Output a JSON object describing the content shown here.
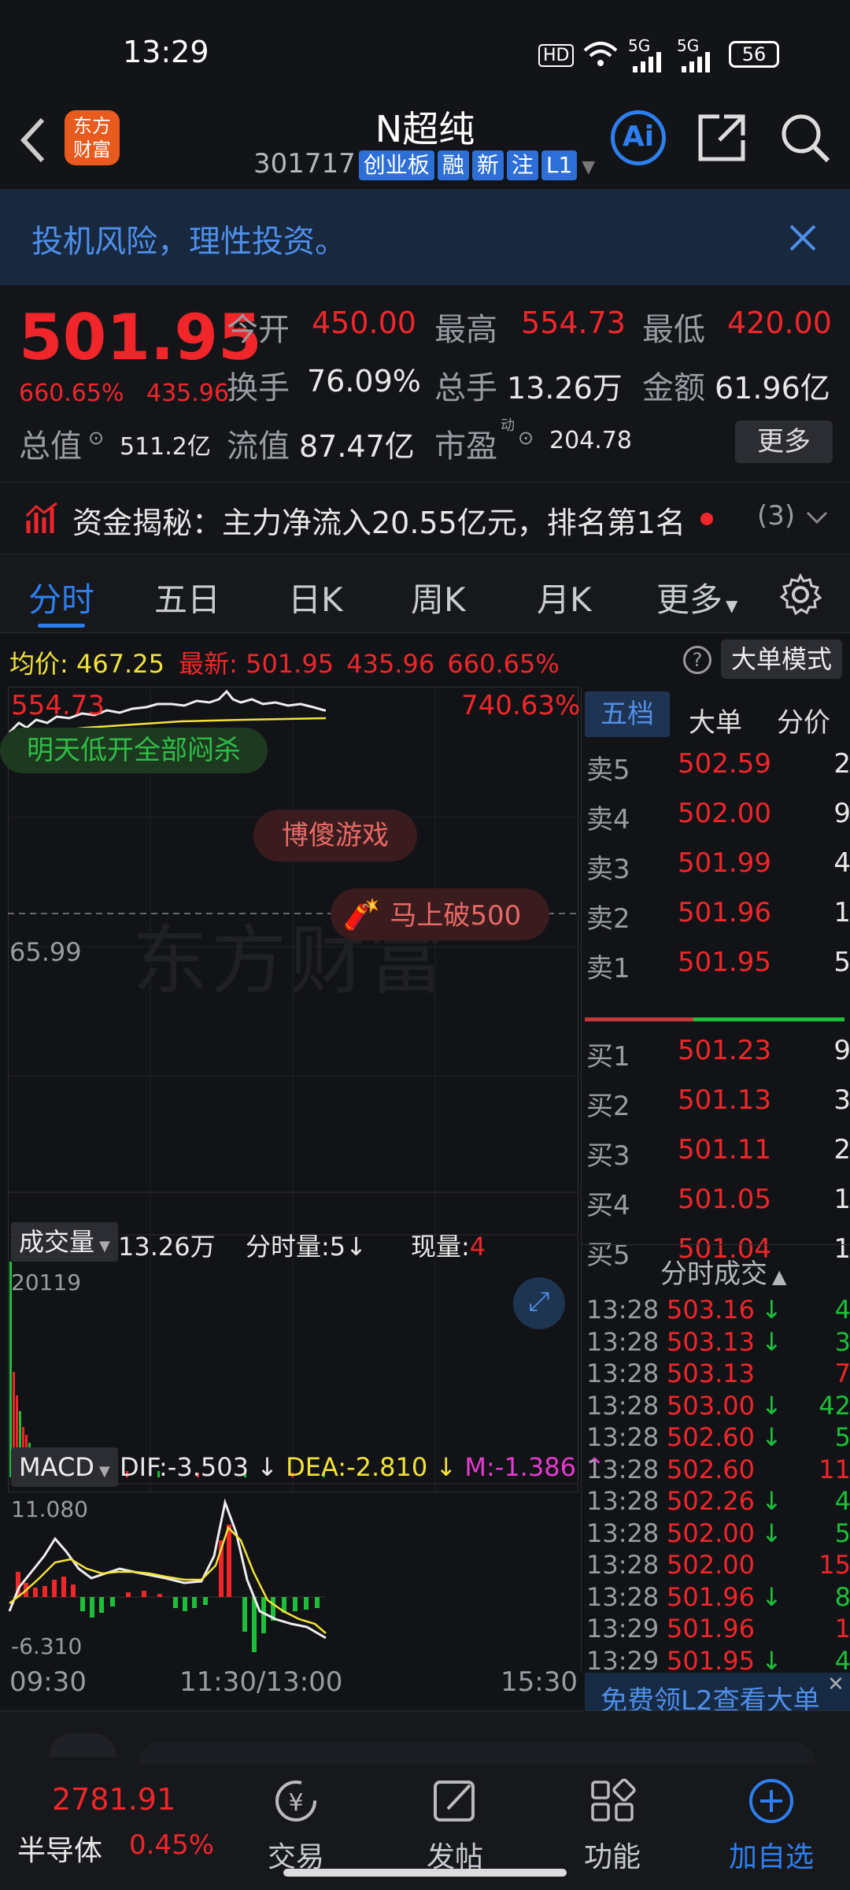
{
  "status": {
    "time": "13:29",
    "hd": "HD",
    "net1": "5G",
    "net2": "5G",
    "battery": "56"
  },
  "nav": {
    "logo_line1": "东方",
    "logo_line2": "财富",
    "name": "N超纯",
    "code": "301717",
    "badges": [
      "创业板",
      "融",
      "新",
      "注",
      "L1"
    ],
    "ai": "Ai"
  },
  "banner": {
    "text": "投机风险，理性投资。"
  },
  "quote": {
    "price": "501.95",
    "change_pct": "660.65%",
    "change": "435.96",
    "open_label": "今开",
    "open": "450.00",
    "high_label": "最高",
    "high": "554.73",
    "low_label": "最低",
    "low": "420.00",
    "turnover_label": "换手",
    "turnover": "76.09%",
    "vol_label": "总手",
    "vol": "13.26万",
    "amount_label": "金额",
    "amount": "61.96亿",
    "mcap_label": "总值",
    "mcap": "511.2亿",
    "float_label": "流值",
    "float": "87.47亿",
    "pe_label": "市盈",
    "pe_sup": "动",
    "pe": "204.78",
    "more": "更多"
  },
  "flow": {
    "text": "资金揭秘：主力净流入20.55亿元，排名第1名",
    "count": "(3)"
  },
  "tabs": [
    "分时",
    "五日",
    "日K",
    "周K",
    "月K",
    "更多"
  ],
  "chart_header": {
    "avg_label": "均价:",
    "avg": "467.25",
    "latest_label": "最新:",
    "latest": "501.95",
    "chg": "435.96",
    "pct": "660.65%",
    "mode": "大单模式"
  },
  "chart": {
    "top_left": "554.73",
    "top_right": "740.63%",
    "mid": "65.99",
    "tag1": "明天低开全部闷杀",
    "tag2": "博傻游戏",
    "tag3": "马上破500",
    "watermark": "东方财富",
    "vol_label": "成交量",
    "vol_total": "13.26万",
    "vol_tick_label": "分时量:5",
    "vol_now_label": "现量:",
    "vol_now": "4",
    "vol_max": "20119",
    "macd_label": "MACD",
    "dif": "DIF:-3.503",
    "dea": "DEA:-2.810",
    "m": "M:-1.386",
    "macd_top": "11.080",
    "macd_bottom": "-6.310",
    "t0": "09:30",
    "t1": "11:30/13:00",
    "t2": "15:30"
  },
  "side": {
    "tabs": [
      "五档",
      "大单",
      "分价"
    ],
    "sells": [
      {
        "l": "卖5",
        "p": "502.59",
        "v": "2"
      },
      {
        "l": "卖4",
        "p": "502.00",
        "v": "9"
      },
      {
        "l": "卖3",
        "p": "501.99",
        "v": "4"
      },
      {
        "l": "卖2",
        "p": "501.96",
        "v": "1"
      },
      {
        "l": "卖1",
        "p": "501.95",
        "v": "5"
      }
    ],
    "buys": [
      {
        "l": "买1",
        "p": "501.23",
        "v": "9"
      },
      {
        "l": "买2",
        "p": "501.13",
        "v": "3"
      },
      {
        "l": "买3",
        "p": "501.11",
        "v": "2"
      },
      {
        "l": "买4",
        "p": "501.05",
        "v": "1"
      },
      {
        "l": "买5",
        "p": "501.04",
        "v": "1"
      }
    ],
    "ticks_title": "分时成交",
    "ticks": [
      {
        "t": "13:28",
        "p": "503.16",
        "a": "↓",
        "v": "4"
      },
      {
        "t": "13:28",
        "p": "503.13",
        "a": "↓",
        "v": "3"
      },
      {
        "t": "13:28",
        "p": "503.13",
        "a": "",
        "v": "7"
      },
      {
        "t": "13:28",
        "p": "503.00",
        "a": "↓",
        "v": "42"
      },
      {
        "t": "13:28",
        "p": "502.60",
        "a": "↓",
        "v": "5"
      },
      {
        "t": "13:28",
        "p": "502.60",
        "a": "",
        "v": "11"
      },
      {
        "t": "13:28",
        "p": "502.26",
        "a": "↓",
        "v": "4"
      },
      {
        "t": "13:28",
        "p": "502.00",
        "a": "↓",
        "v": "5"
      },
      {
        "t": "13:28",
        "p": "502.00",
        "a": "",
        "v": "15"
      },
      {
        "t": "13:28",
        "p": "501.96",
        "a": "↓",
        "v": "8"
      },
      {
        "t": "13:29",
        "p": "501.96",
        "a": "",
        "v": "1"
      },
      {
        "t": "13:29",
        "p": "501.95",
        "a": "↓",
        "v": "4"
      }
    ],
    "promo": "免费领L2查看大单"
  },
  "bottom": {
    "index_value": "2781.91",
    "index_name": "半导体",
    "index_pct": "0.45%",
    "trade": "交易",
    "post": "发帖",
    "func": "功能",
    "watch": "加自选"
  },
  "colors": {
    "up": "#f0262a",
    "down": "#1dbf3a",
    "accent": "#2d6fd6",
    "bg": "#141519"
  }
}
